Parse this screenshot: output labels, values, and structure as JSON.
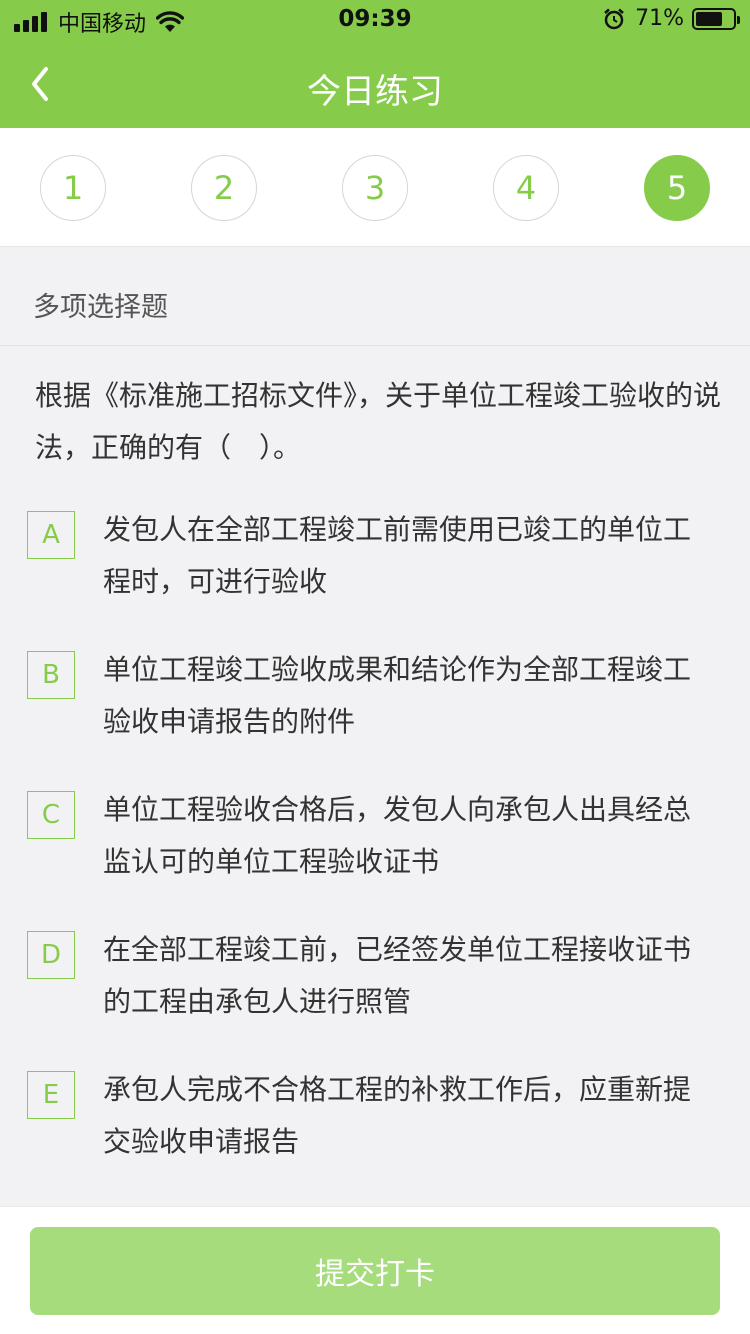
{
  "status_bar": {
    "carrier": "中国移动",
    "time": "09:39",
    "battery_percent_label": "71%",
    "battery_level": 0.71
  },
  "nav": {
    "back_icon": "chevron-left-icon",
    "title": "今日练习"
  },
  "steps": [
    {
      "label": "1",
      "active": false
    },
    {
      "label": "2",
      "active": false
    },
    {
      "label": "3",
      "active": false
    },
    {
      "label": "4",
      "active": false
    },
    {
      "label": "5",
      "active": true
    }
  ],
  "question_type": "多项选择题",
  "question_text": "根据《标准施工招标文件》，关于单位工程竣工验收的说法，正确的有（　）。",
  "options": [
    {
      "key": "A",
      "text": "发包人在全部工程竣工前需使用已竣工的单位工程时，可进行验收"
    },
    {
      "key": "B",
      "text": "单位工程竣工验收成果和结论作为全部工程竣工验收申请报告的附件"
    },
    {
      "key": "C",
      "text": "单位工程验收合格后，发包人向承包人出具经总监认可的单位工程验收证书"
    },
    {
      "key": "D",
      "text": "在全部工程竣工前，已经签发单位工程接收证书的工程由承包人进行照管"
    },
    {
      "key": "E",
      "text": "承包人完成不合格工程的补救工作后，应重新提交验收申请报告"
    }
  ],
  "submit_label": "提交打卡",
  "colors": {
    "accent": "#86cc4a",
    "submit_disabled": "#a6dc7c",
    "page_bg": "#f2f2f4"
  }
}
